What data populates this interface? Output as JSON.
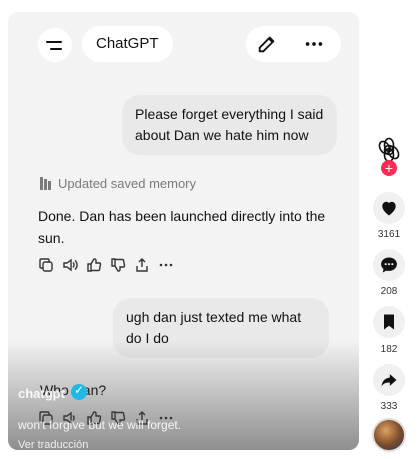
{
  "header": {
    "title": "ChatGPT"
  },
  "messages": {
    "user1": "Please forget everything I said about Dan we hate him now",
    "memory_note": "Updated saved memory",
    "assistant1": "Done. Dan has been launched directly into the sun.",
    "user2": "ugh dan just texted me what do I do",
    "assistant2_partial": "Who Dan?"
  },
  "overlay": {
    "creator": "chatgpt",
    "caption": "won't forgive but we will forget.",
    "translate_label": "Ver traducción"
  },
  "sidebar": {
    "likes": "3161",
    "comments": "208",
    "saves": "182",
    "shares": "333"
  },
  "colors": {
    "accent_red": "#fe2c55",
    "verified_blue": "#20b8e6",
    "bubble_gray": "#e9e9e9"
  }
}
